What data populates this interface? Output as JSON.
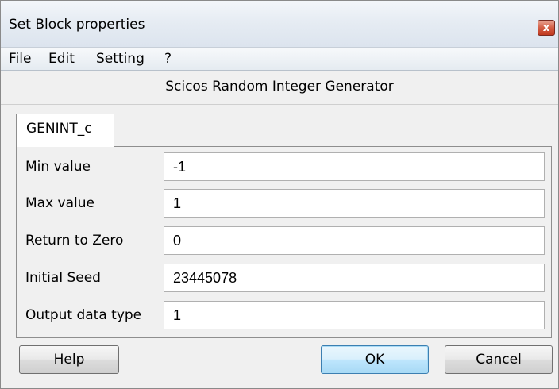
{
  "window": {
    "title": "Set Block properties",
    "close_symbol": "x"
  },
  "menu": {
    "items": [
      "File",
      "Edit",
      "Setting",
      "?"
    ]
  },
  "header": {
    "title": "Scicos Random Integer Generator"
  },
  "tab": {
    "label": "GENINT_c"
  },
  "form": {
    "fields": [
      {
        "label": "Min value",
        "value": "-1"
      },
      {
        "label": "Max value",
        "value": "1"
      },
      {
        "label": "Return to Zero",
        "value": "0"
      },
      {
        "label": "Initial Seed",
        "value": "23445078"
      },
      {
        "label": "Output data type",
        "value": "1"
      }
    ]
  },
  "buttons": {
    "help": "Help",
    "ok": "OK",
    "cancel": "Cancel"
  },
  "colors": {
    "close_button": "#d35d44",
    "default_button_border": "#3c7fb1"
  }
}
